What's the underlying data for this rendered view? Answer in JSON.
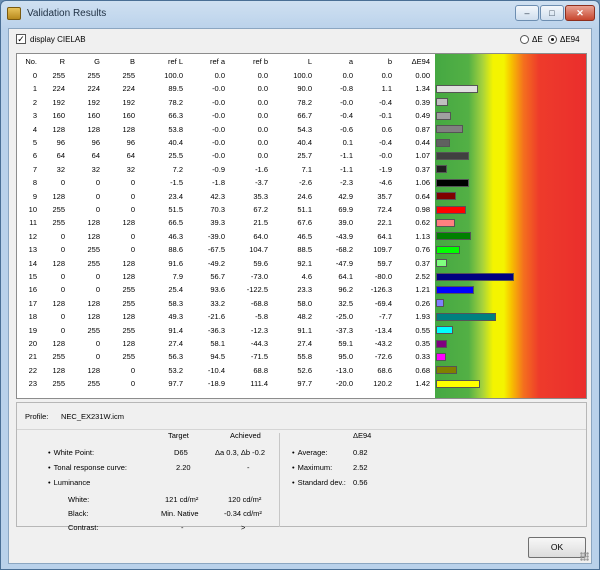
{
  "window": {
    "title": "Validation Results",
    "minimize": "–",
    "maximize": "□",
    "close": "✕"
  },
  "controls": {
    "checkbox_label": "display CIELAB",
    "checkbox_checked": true,
    "radio_de": "ΔE",
    "radio_de94": "ΔE94",
    "selected": "ΔE94"
  },
  "table": {
    "headers": [
      "No.",
      "R",
      "G",
      "B",
      "ref L",
      "ref a",
      "ref b",
      "L",
      "a",
      "b",
      "ΔE94"
    ],
    "rows": [
      [
        "0",
        "255",
        "255",
        "255",
        "100.0",
        "0.0",
        "0.0",
        "100.0",
        "0.0",
        "0.0",
        "0.00"
      ],
      [
        "1",
        "224",
        "224",
        "224",
        "89.5",
        "-0.0",
        "0.0",
        "90.0",
        "-0.8",
        "1.1",
        "1.34"
      ],
      [
        "2",
        "192",
        "192",
        "192",
        "78.2",
        "-0.0",
        "0.0",
        "78.2",
        "-0.0",
        "-0.4",
        "0.39"
      ],
      [
        "3",
        "160",
        "160",
        "160",
        "66.3",
        "-0.0",
        "0.0",
        "66.7",
        "-0.4",
        "-0.1",
        "0.49"
      ],
      [
        "4",
        "128",
        "128",
        "128",
        "53.8",
        "-0.0",
        "0.0",
        "54.3",
        "-0.6",
        "0.6",
        "0.87"
      ],
      [
        "5",
        "96",
        "96",
        "96",
        "40.4",
        "-0.0",
        "0.0",
        "40.4",
        "0.1",
        "-0.4",
        "0.44"
      ],
      [
        "6",
        "64",
        "64",
        "64",
        "25.5",
        "-0.0",
        "0.0",
        "25.7",
        "-1.1",
        "-0.0",
        "1.07"
      ],
      [
        "7",
        "32",
        "32",
        "32",
        "7.2",
        "-0.9",
        "-1.6",
        "7.1",
        "-1.1",
        "-1.9",
        "0.37"
      ],
      [
        "8",
        "0",
        "0",
        "0",
        "-1.5",
        "-1.8",
        "-3.7",
        "-2.6",
        "-2.3",
        "-4.6",
        "1.06"
      ],
      [
        "9",
        "128",
        "0",
        "0",
        "23.4",
        "42.3",
        "35.3",
        "24.6",
        "42.9",
        "35.7",
        "0.64"
      ],
      [
        "10",
        "255",
        "0",
        "0",
        "51.5",
        "70.3",
        "67.2",
        "51.1",
        "69.9",
        "72.4",
        "0.98"
      ],
      [
        "11",
        "255",
        "128",
        "128",
        "66.5",
        "39.3",
        "21.5",
        "67.6",
        "39.0",
        "22.1",
        "0.62"
      ],
      [
        "12",
        "0",
        "128",
        "0",
        "46.3",
        "-39.0",
        "64.0",
        "46.5",
        "-43.9",
        "64.1",
        "1.13"
      ],
      [
        "13",
        "0",
        "255",
        "0",
        "88.6",
        "-67.5",
        "104.7",
        "88.5",
        "-68.2",
        "109.7",
        "0.76"
      ],
      [
        "14",
        "128",
        "255",
        "128",
        "91.6",
        "-49.2",
        "59.6",
        "92.1",
        "-47.9",
        "59.7",
        "0.37"
      ],
      [
        "15",
        "0",
        "0",
        "128",
        "7.9",
        "56.7",
        "-73.0",
        "4.6",
        "64.1",
        "-80.0",
        "2.52"
      ],
      [
        "16",
        "0",
        "0",
        "255",
        "25.4",
        "93.6",
        "-122.5",
        "23.3",
        "96.2",
        "-126.3",
        "1.21"
      ],
      [
        "17",
        "128",
        "128",
        "255",
        "58.3",
        "33.2",
        "-68.8",
        "58.0",
        "32.5",
        "-69.4",
        "0.26"
      ],
      [
        "18",
        "0",
        "128",
        "128",
        "49.3",
        "-21.6",
        "-5.8",
        "48.2",
        "-25.0",
        "-7.7",
        "1.93"
      ],
      [
        "19",
        "0",
        "255",
        "255",
        "91.4",
        "-36.3",
        "-12.3",
        "91.1",
        "-37.3",
        "-13.4",
        "0.55"
      ],
      [
        "20",
        "128",
        "0",
        "128",
        "27.4",
        "58.1",
        "-44.3",
        "27.4",
        "59.1",
        "-43.2",
        "0.35"
      ],
      [
        "21",
        "255",
        "0",
        "255",
        "56.3",
        "94.5",
        "-71.5",
        "55.8",
        "95.0",
        "-72.6",
        "0.33"
      ],
      [
        "22",
        "128",
        "128",
        "0",
        "53.2",
        "-10.4",
        "68.8",
        "52.6",
        "-13.0",
        "68.6",
        "0.68"
      ],
      [
        "23",
        "255",
        "255",
        "0",
        "97.7",
        "-18.9",
        "111.4",
        "97.7",
        "-20.0",
        "120.2",
        "1.42"
      ]
    ],
    "bar_colors": [
      "#ffffff",
      "#e0e0e0",
      "#c0c0c0",
      "#a0a0a0",
      "#808080",
      "#606060",
      "#404040",
      "#202020",
      "#000000",
      "#800000",
      "#ff0000",
      "#ff8080",
      "#008000",
      "#00ff00",
      "#80ff80",
      "#000080",
      "#0000ff",
      "#8080ff",
      "#008080",
      "#00ffff",
      "#800080",
      "#ff00ff",
      "#808000",
      "#ffff00"
    ]
  },
  "summary": {
    "profile_label": "Profile:",
    "profile_value": "NEC_EX231W.icm",
    "col_target": "Target",
    "col_achieved": "Achieved",
    "white_point_label": "White Point:",
    "white_point_target": "D65",
    "white_point_achieved": "Δa 0.3, Δb -0.2",
    "trc_label": "Tonal response curve:",
    "trc_target": "2.20",
    "trc_achieved": "-",
    "luminance_label": "Luminance",
    "white_label": "White:",
    "white_target": "121 cd/m²",
    "white_achieved": "120 cd/m²",
    "black_label": "Black:",
    "black_target": "Min. Native",
    "black_achieved": "-0.34 cd/m²",
    "contrast_label": "Contrast:",
    "contrast_target": "-",
    "contrast_achieved": ">",
    "de94_header": "ΔE94",
    "average_label": "Average:",
    "average_value": "0.82",
    "maximum_label": "Maximum:",
    "maximum_value": "2.52",
    "stddev_label": "Standard dev.:",
    "stddev_value": "0.56"
  },
  "buttons": {
    "ok": "OK"
  }
}
